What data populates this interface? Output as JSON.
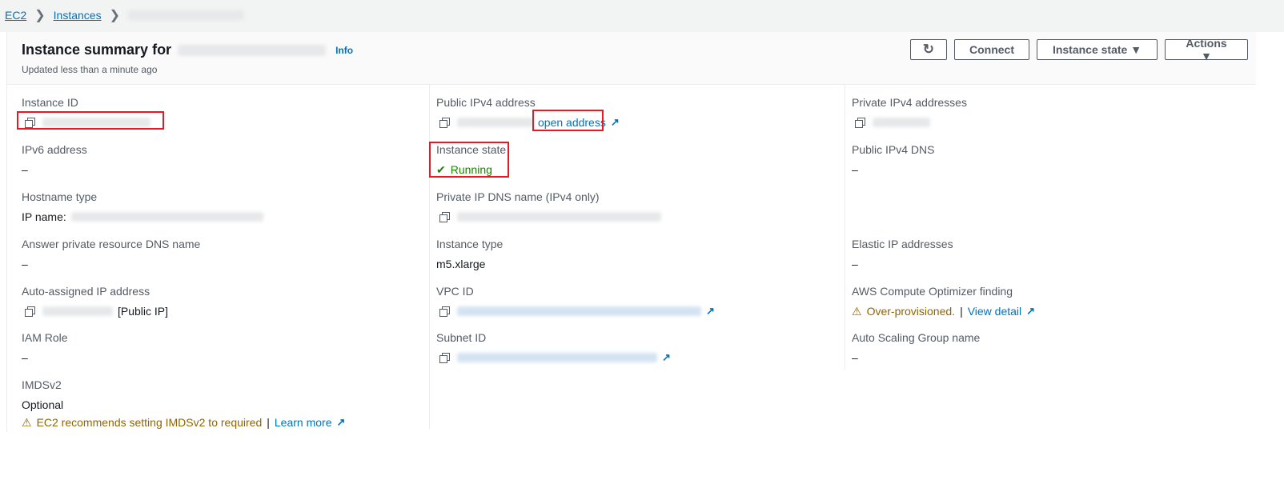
{
  "breadcrumb": {
    "items": [
      "EC2",
      "Instances"
    ]
  },
  "header": {
    "title": "Instance summary for",
    "info": "Info",
    "updated": "Updated less than a minute ago",
    "buttons": {
      "refresh": "refresh-icon",
      "connect": "Connect",
      "instance_state": "Instance state ▼",
      "actions": "Actions ▼"
    }
  },
  "col1": {
    "instance_id": "Instance ID",
    "ipv6": "IPv6 address",
    "ipv6_val": "–",
    "hostname_type": "Hostname type",
    "ip_name": "IP name:",
    "answer_dns": "Answer private resource DNS name",
    "answer_dns_val": "–",
    "auto_ip": "Auto-assigned IP address",
    "auto_ip_suffix": "[Public IP]",
    "iam": "IAM Role",
    "iam_val": "–",
    "imds": "IMDSv2",
    "imds_val": "Optional",
    "imds_warn": "EC2 recommends setting IMDSv2 to required",
    "imds_sep": "|",
    "learn_more": "Learn more"
  },
  "col2": {
    "public_ipv4": "Public IPv4 address",
    "open_address": "open address",
    "state": "Instance state",
    "state_val": "Running",
    "private_dns": "Private IP DNS name (IPv4 only)",
    "type": "Instance type",
    "type_val": "m5.xlarge",
    "vpc": "VPC ID",
    "subnet": "Subnet ID"
  },
  "col3": {
    "private_ipv4": "Private IPv4 addresses",
    "public_dns": "Public IPv4 DNS",
    "public_dns_val": "–",
    "elastic": "Elastic IP addresses",
    "elastic_val": "–",
    "optimizer": "AWS Compute Optimizer finding",
    "optimizer_val": "Over-provisioned.",
    "optimizer_sep": "|",
    "view_detail": "View detail",
    "asg": "Auto Scaling Group name",
    "asg_val": "–"
  },
  "colors": {
    "link": "#0073bb",
    "running": "#1d8102",
    "warning": "#8d6605",
    "highlight": "#e51a24"
  }
}
